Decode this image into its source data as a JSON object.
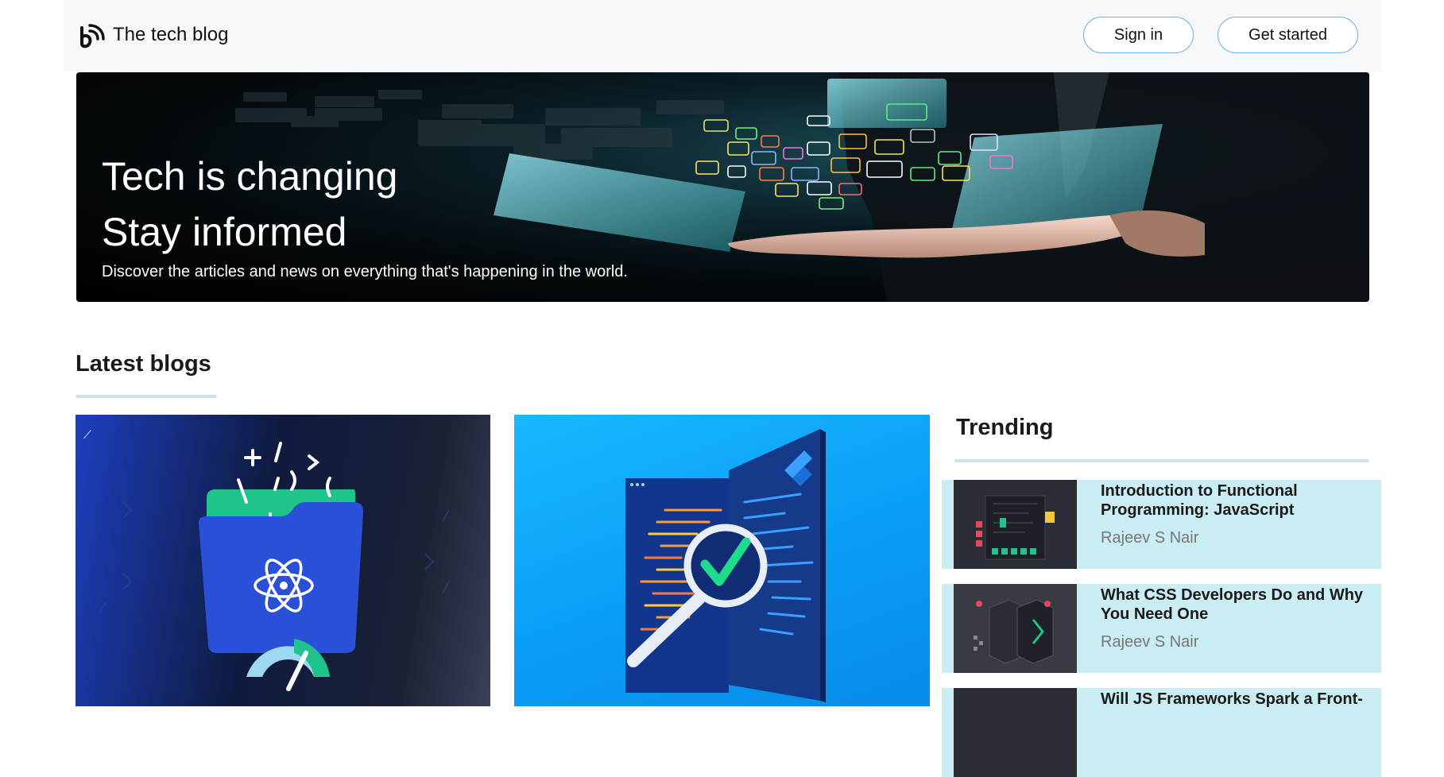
{
  "brand": {
    "name": "The tech blog"
  },
  "nav": {
    "sign_in": "Sign in",
    "get_started": "Get started"
  },
  "hero": {
    "title_line1": "Tech is changing",
    "title_line2": "Stay informed",
    "subtitle": "Discover the articles and news on everything that's happening in the world."
  },
  "latest": {
    "heading": "Latest blogs"
  },
  "trending": {
    "heading": "Trending",
    "items": [
      {
        "title": "Introduction to Functional Programming: JavaScript",
        "author": "Rajeev S Nair"
      },
      {
        "title": "What CSS Developers Do and Why You Need One",
        "author": "Rajeev S Nair"
      },
      {
        "title": "Will JS Frameworks Spark a Front-",
        "author": ""
      }
    ]
  },
  "colors": {
    "accent": "#6fb3e0",
    "trending_bg": "#caecf3",
    "underline": "#c9e2f3"
  }
}
